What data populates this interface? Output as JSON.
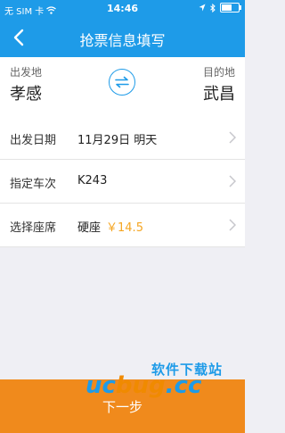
{
  "status": {
    "carrier": "无 SIM 卡",
    "time": "14:46"
  },
  "nav": {
    "title": "抢票信息填写"
  },
  "stations": {
    "from_label": "出发地",
    "from_city": "孝感",
    "to_label": "目的地",
    "to_city": "武昌"
  },
  "rows": [
    {
      "label": "出发日期",
      "value": "11月29日 明天"
    },
    {
      "label": "指定车次",
      "value": "K243"
    },
    {
      "label": "选择座席",
      "value": "硬座",
      "price": "￥14.5"
    }
  ],
  "watermark": {
    "cn": "软件下载站",
    "en_prefix": "uc",
    "en_mid": "bug",
    "en_suffix": ".cc"
  },
  "footer": {
    "next_label": "下一步"
  },
  "colors": {
    "primary": "#1e9be8",
    "accent": "#f08a1c",
    "price": "#f5a623"
  }
}
